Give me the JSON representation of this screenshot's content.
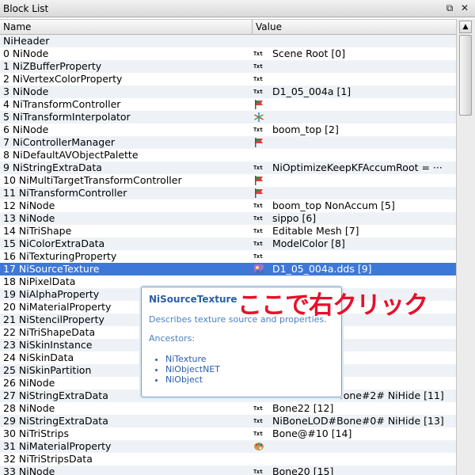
{
  "window": {
    "title": "Block List",
    "float_icon": "float-window-icon",
    "close_icon": "close-icon"
  },
  "columns": {
    "name": "Name",
    "value": "Value"
  },
  "rows": [
    {
      "name": "NiHeader",
      "icon": "",
      "value": ""
    },
    {
      "name": "0 NiNode",
      "icon": "txt",
      "value": "Scene Root [0]"
    },
    {
      "name": "1 NiZBufferProperty",
      "icon": "txt",
      "value": ""
    },
    {
      "name": "2 NiVertexColorProperty",
      "icon": "txt",
      "value": ""
    },
    {
      "name": "3 NiNode",
      "icon": "txt",
      "value": "D1_05_004a [1]"
    },
    {
      "name": "4 NiTransformController",
      "icon": "flag",
      "value": ""
    },
    {
      "name": "5 NiTransformInterpolator",
      "icon": "star",
      "value": ""
    },
    {
      "name": "6 NiNode",
      "icon": "txt",
      "value": "boom_top [2]"
    },
    {
      "name": "7 NiControllerManager",
      "icon": "flag",
      "value": ""
    },
    {
      "name": "8 NiDefaultAVObjectPalette",
      "icon": "",
      "value": ""
    },
    {
      "name": "9 NiStringExtraData",
      "icon": "txt",
      "value": "NiOptimizeKeepKFAccumRoot = ···"
    },
    {
      "name": "10 NiMultiTargetTransformController",
      "icon": "flag",
      "value": ""
    },
    {
      "name": "11 NiTransformController",
      "icon": "flag",
      "value": ""
    },
    {
      "name": "12 NiNode",
      "icon": "txt",
      "value": "boom_top NonAccum [5]"
    },
    {
      "name": "13 NiNode",
      "icon": "txt",
      "value": "sippo [6]"
    },
    {
      "name": "14 NiTriShape",
      "icon": "txt",
      "value": "Editable Mesh [7]"
    },
    {
      "name": "15 NiColorExtraData",
      "icon": "txt",
      "value": "ModelColor [8]"
    },
    {
      "name": "16 NiTexturingProperty",
      "icon": "txt",
      "value": ""
    },
    {
      "name": "17 NiSourceTexture",
      "icon": "texture",
      "value": "D1_05_004a.dds [9]",
      "selected": true
    },
    {
      "name": "18 NiPixelData",
      "icon": "",
      "value": ""
    },
    {
      "name": "19 NiAlphaProperty",
      "icon": "",
      "value": ""
    },
    {
      "name": "20 NiMaterialProperty",
      "icon": "",
      "value": "1]"
    },
    {
      "name": "21 NiStencilProperty",
      "icon": "",
      "value": ""
    },
    {
      "name": "22 NiTriShapeData",
      "icon": "",
      "value": ""
    },
    {
      "name": "23 NiSkinInstance",
      "icon": "",
      "value": ""
    },
    {
      "name": "24 NiSkinData",
      "icon": "",
      "value": ""
    },
    {
      "name": "25 NiSkinPartition",
      "icon": "",
      "value": ""
    },
    {
      "name": "26 NiNode",
      "icon": "",
      "value": ""
    },
    {
      "name": "27 NiStringExtraData",
      "icon": "txt",
      "value": "NiBoneLOD#Bone#2#   NiHide [11]"
    },
    {
      "name": "28 NiNode",
      "icon": "txt",
      "value": "Bone22 [12]"
    },
    {
      "name": "29 NiStringExtraData",
      "icon": "txt",
      "value": "NiBoneLOD#Bone#0# NiHide [13]"
    },
    {
      "name": "30 NiTriStrips",
      "icon": "txt",
      "value": "Bone@#10 [14]"
    },
    {
      "name": "31 NiMaterialProperty",
      "icon": "palette",
      "value": ""
    },
    {
      "name": "32 NiTriStripsData",
      "icon": "",
      "value": ""
    },
    {
      "name": "33 NiNode",
      "icon": "txt",
      "value": "Bone20 [15]"
    }
  ],
  "icons": {
    "txt_label": "Txt"
  },
  "tooltip": {
    "title": "NiSourceTexture",
    "description": "Describes texture source and properties.",
    "ancestors_label": "Ancestors:",
    "ancestors": [
      "NiTexture",
      "NiObjectNET",
      "NiObject"
    ]
  },
  "annotation": {
    "text": "ここで右クリック",
    "color": "#e8102a"
  },
  "colors": {
    "selection": "#3d78d8",
    "tooltip_border": "#7aa0c8"
  }
}
